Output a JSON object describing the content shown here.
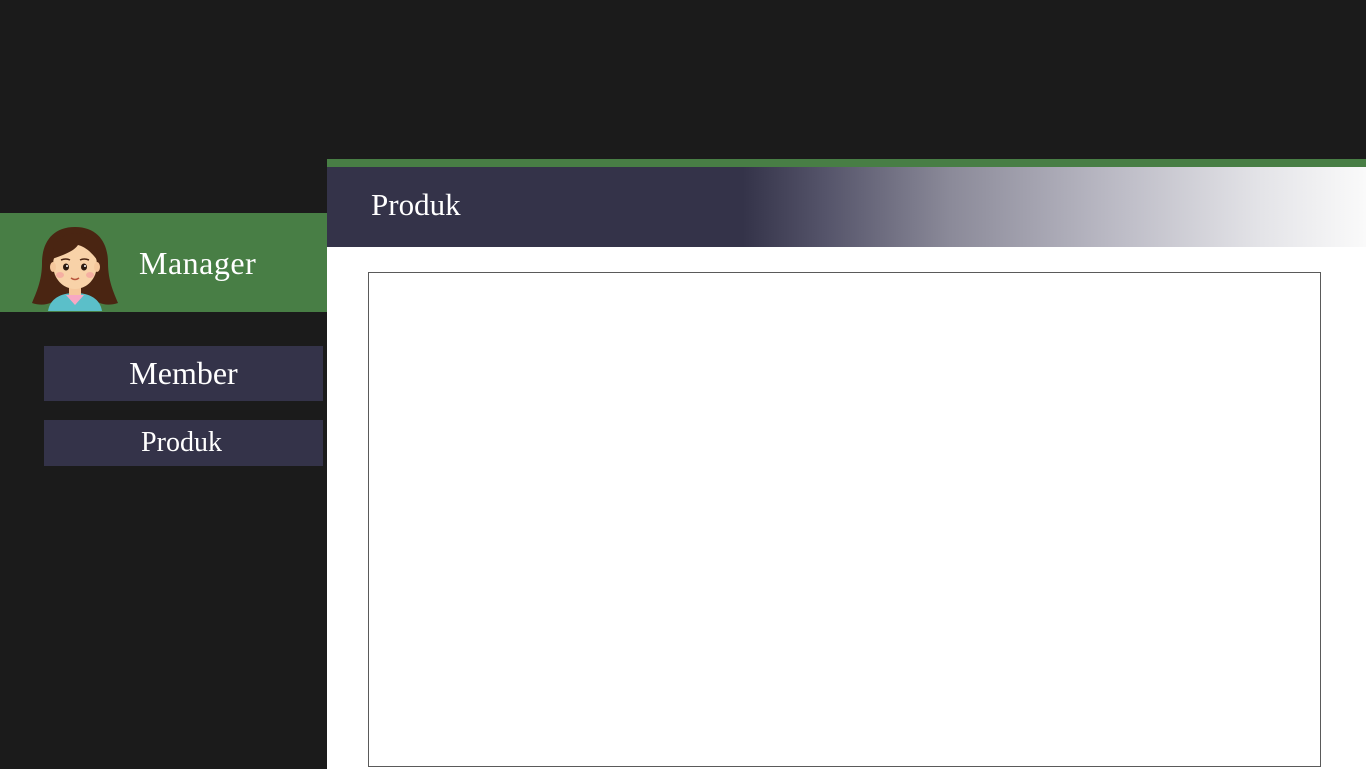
{
  "sidebar": {
    "profile": {
      "avatar_icon": "woman-avatar-icon",
      "role": "Manager"
    },
    "nav": [
      {
        "label": "Member"
      },
      {
        "label": "Produk"
      }
    ]
  },
  "header": {
    "title": "Produk"
  },
  "colors": {
    "background": "#1b1b1b",
    "accent_green": "#487e45",
    "navy": "#343349",
    "content_bg": "#ffffff"
  }
}
